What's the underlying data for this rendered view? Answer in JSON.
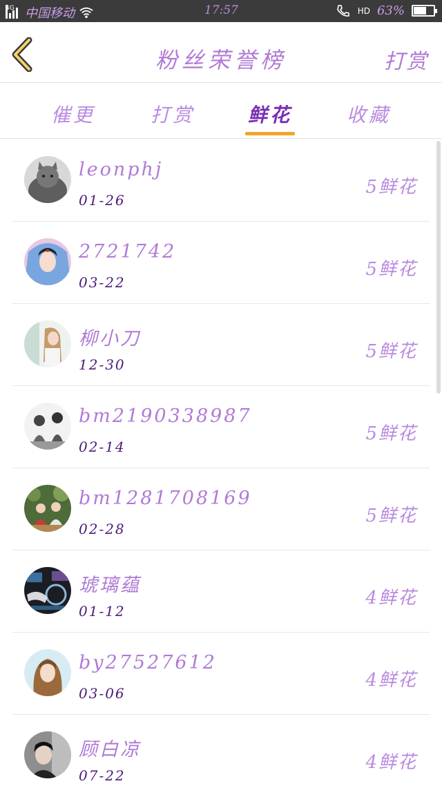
{
  "status_bar": {
    "network": "4G",
    "carrier": "中国移动",
    "time": "17:57",
    "hd_label": "HD",
    "battery_pct": "63%",
    "battery_level": 0.63
  },
  "header": {
    "title": "粉丝荣誉榜",
    "action_label": "打赏",
    "back_icon": "chevron-left-icon"
  },
  "tabs": [
    {
      "label": "催更",
      "active": false
    },
    {
      "label": "打赏",
      "active": false
    },
    {
      "label": "鲜花",
      "active": true
    },
    {
      "label": "收藏",
      "active": false
    }
  ],
  "colors": {
    "accent": "#b07ad6",
    "active_tab": "#7a2fb5",
    "underline": "#f2a52c",
    "date": "#4b1a7a"
  },
  "fans": [
    {
      "name": "leonphj",
      "date": "01-26",
      "count": "5鲜花",
      "avatar": "cat"
    },
    {
      "name": "2721742",
      "date": "03-22",
      "count": "5鲜花",
      "avatar": "girl-blue-veil"
    },
    {
      "name": "柳小刀",
      "date": "12-30",
      "count": "5鲜花",
      "avatar": "girl-light"
    },
    {
      "name": "bm2190338987",
      "date": "02-14",
      "count": "5鲜花",
      "avatar": "bw-couple"
    },
    {
      "name": "bm1281708169",
      "date": "02-28",
      "count": "5鲜花",
      "avatar": "kids-garden"
    },
    {
      "name": "琥璃蕴",
      "date": "01-12",
      "count": "4鲜花",
      "avatar": "dark-tech"
    },
    {
      "name": "by27527612",
      "date": "03-06",
      "count": "4鲜花",
      "avatar": "girl-long-hair"
    },
    {
      "name": "顾白凉",
      "date": "07-22",
      "count": "4鲜花",
      "avatar": "boy-photo"
    }
  ]
}
